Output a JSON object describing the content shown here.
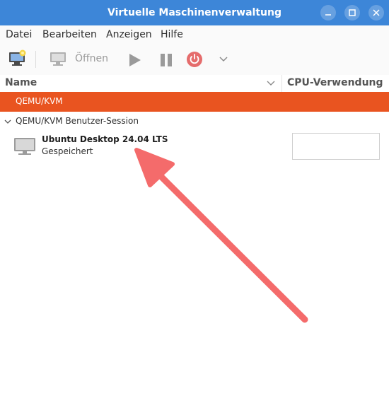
{
  "window": {
    "title": "Virtuelle Maschinenverwaltung"
  },
  "menubar": {
    "items": [
      {
        "label": "Datei"
      },
      {
        "label": "Bearbeiten"
      },
      {
        "label": "Anzeigen"
      },
      {
        "label": "Hilfe"
      }
    ]
  },
  "toolbar": {
    "new_vm_icon": "new-vm-icon",
    "open_label": "Öffnen",
    "run_icon": "play-icon",
    "pause_icon": "pause-icon",
    "shutdown_icon": "power-icon",
    "dropdown_icon": "chevron-down-icon",
    "accent_power": "#e56c6c"
  },
  "columns": {
    "name": "Name",
    "cpu": "CPU-Verwendung"
  },
  "connections": [
    {
      "label": "QEMU/KVM",
      "selected": true,
      "color": "#e95420"
    },
    {
      "label": "QEMU/KVM Benutzer-Session",
      "expanded": true
    }
  ],
  "vms": [
    {
      "name": "Ubuntu Desktop 24.04 LTS",
      "status": "Gespeichert",
      "icon": "monitor-icon"
    }
  ],
  "annotation": {
    "type": "arrow",
    "color": "#f46b6b"
  }
}
